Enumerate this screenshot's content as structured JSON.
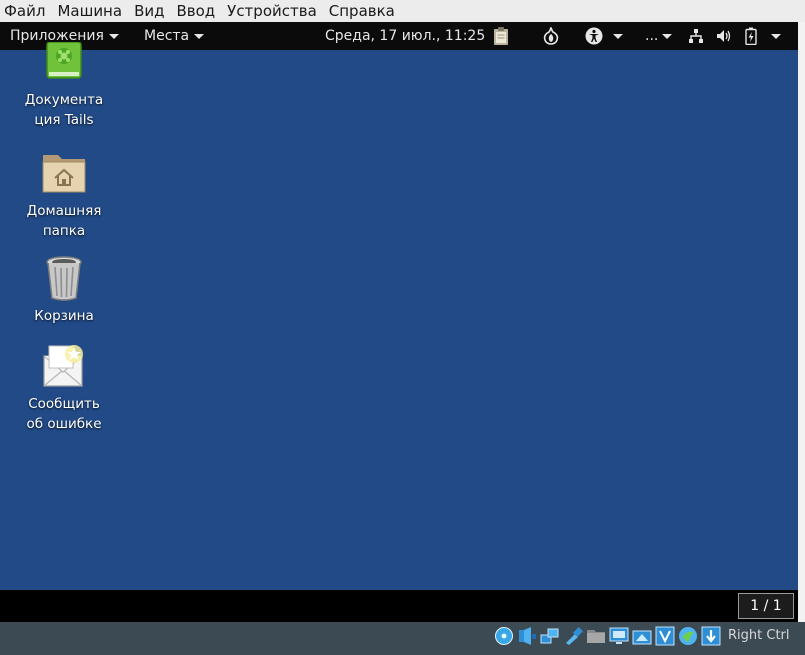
{
  "vbox_menu": [
    "Файл",
    "Машина",
    "Вид",
    "Ввод",
    "Устройства",
    "Справка"
  ],
  "top_bar": {
    "applications": "Приложения",
    "places": "Места",
    "clock": "Среда, 17 июл., 11:25",
    "ellipsis": "..."
  },
  "desktop_icons": [
    {
      "label": "Документа\nция Tails",
      "icon": "tails-docs-icon"
    },
    {
      "label": "Домашняя\nпапка",
      "icon": "home-folder-icon"
    },
    {
      "label": "Корзина",
      "icon": "trash-icon"
    },
    {
      "label": "Сообщить\nоб ошибке",
      "icon": "bug-report-icon"
    }
  ],
  "workspace": "1 / 1",
  "host_key": "Right Ctrl",
  "colors": {
    "desktop": "#214a86",
    "top_bar": "#0b0b0b",
    "status_bar": "#3c4a54"
  }
}
